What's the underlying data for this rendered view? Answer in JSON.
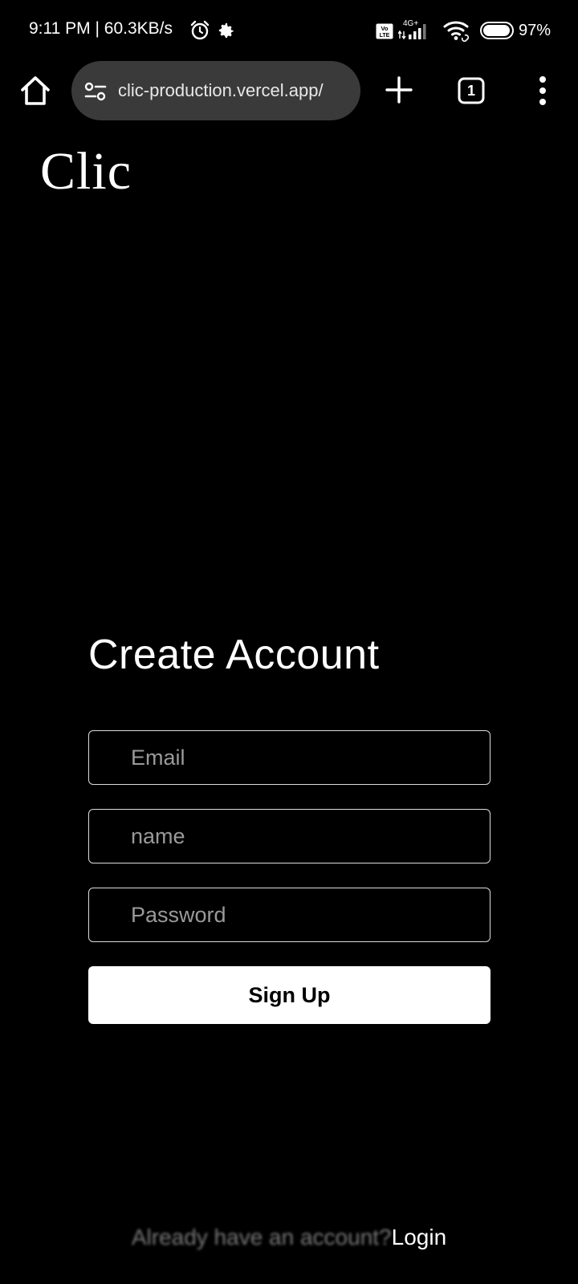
{
  "status_bar": {
    "time_speed": "9:11 PM | 60.3KB/s",
    "network_type": "4G+",
    "battery_percent": "97%"
  },
  "browser": {
    "url": "clic-production.vercel.app/",
    "tab_count": "1"
  },
  "page": {
    "logo": "Clic",
    "title": "Create Account",
    "email_placeholder": "Email",
    "name_placeholder": "name",
    "password_placeholder": "Password",
    "signup_label": "Sign Up",
    "login_prompt": "Already have an account?",
    "login_link": "Login"
  },
  "colors": {
    "background": "#000000",
    "url_pill": "#3a3a3a",
    "primary_button": "#ffffff",
    "field_border": "#dcdcdc",
    "placeholder": "#9a9a9a"
  }
}
